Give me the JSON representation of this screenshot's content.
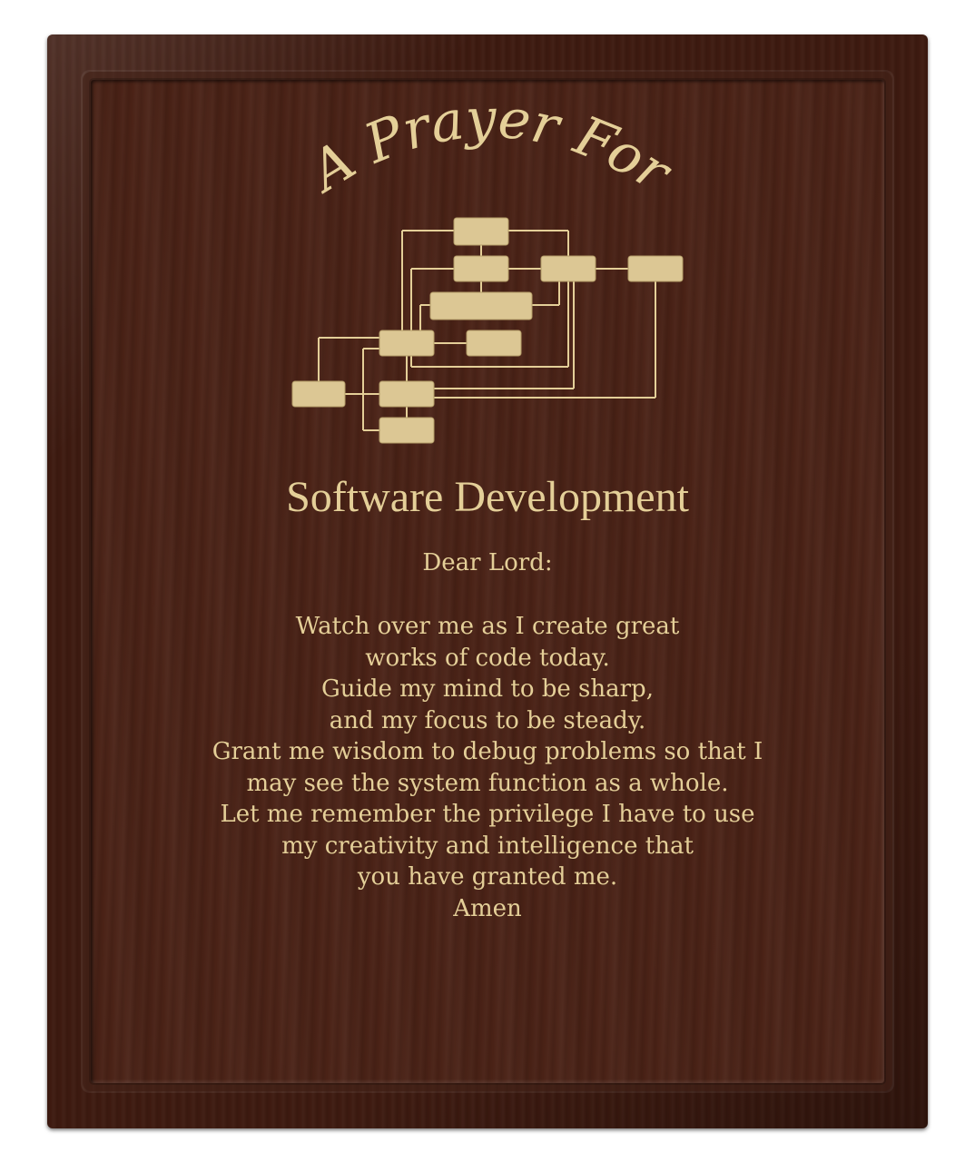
{
  "plaque": {
    "heading": "A Prayer For",
    "subject": "Software Development",
    "salutation": "Dear Lord:",
    "lines": [
      "Watch over me as I create great",
      "works of code today.",
      "Guide my mind to be sharp,",
      "and my focus to be steady.",
      "Grant me wisdom to debug problems so that I",
      "may see the system function as a whole.",
      "Let me remember the privilege I have to use",
      "my creativity and intelligence that",
      "you have granted me.",
      "Amen"
    ],
    "colors": {
      "wood": "#4a2216",
      "engraving": "#e4cf98"
    },
    "icon": "flowchart-icon"
  }
}
